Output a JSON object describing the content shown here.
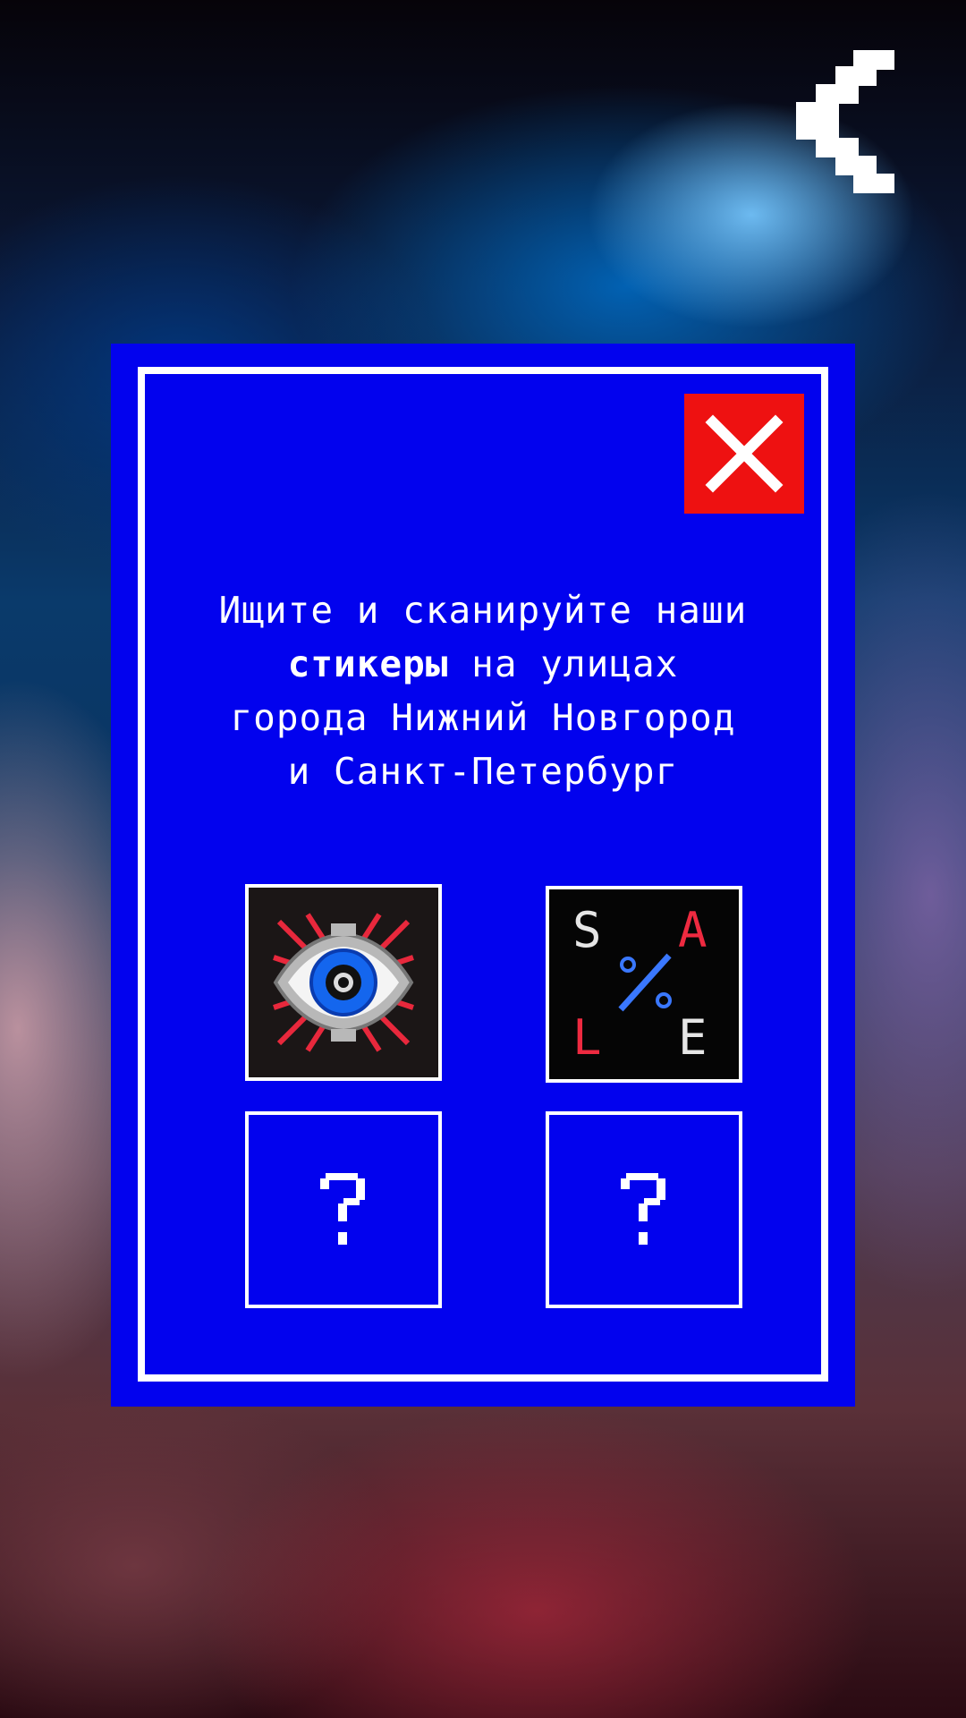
{
  "background": {
    "description_colors": [
      "#0a3a6b",
      "#5a3038"
    ]
  },
  "back_button": {
    "icon": "pixel-chevron-left-icon",
    "color": "#ffffff"
  },
  "dialog": {
    "background_color": "#0202ee",
    "border_color": "#ffffff",
    "close_button": {
      "icon": "close-icon",
      "color": "#ee1111"
    },
    "message": {
      "line1": "Ищите и сканируйте наши",
      "line2_bold": "стикеры",
      "line2_rest": " на улицах",
      "line3": "города Нижний Новгород",
      "line4": "и Санкт-Петербург"
    },
    "stickers": [
      {
        "name": "eye-sticker",
        "status": "found",
        "icon": "pixel-eye-icon"
      },
      {
        "name": "sale-sticker",
        "status": "found",
        "icon": "sale-percent-icon",
        "letters": [
          "S",
          "A",
          "L",
          "E"
        ]
      },
      {
        "name": "locked-sticker",
        "status": "unknown",
        "symbol": "?"
      },
      {
        "name": "locked-sticker",
        "status": "unknown",
        "symbol": "?"
      }
    ]
  }
}
